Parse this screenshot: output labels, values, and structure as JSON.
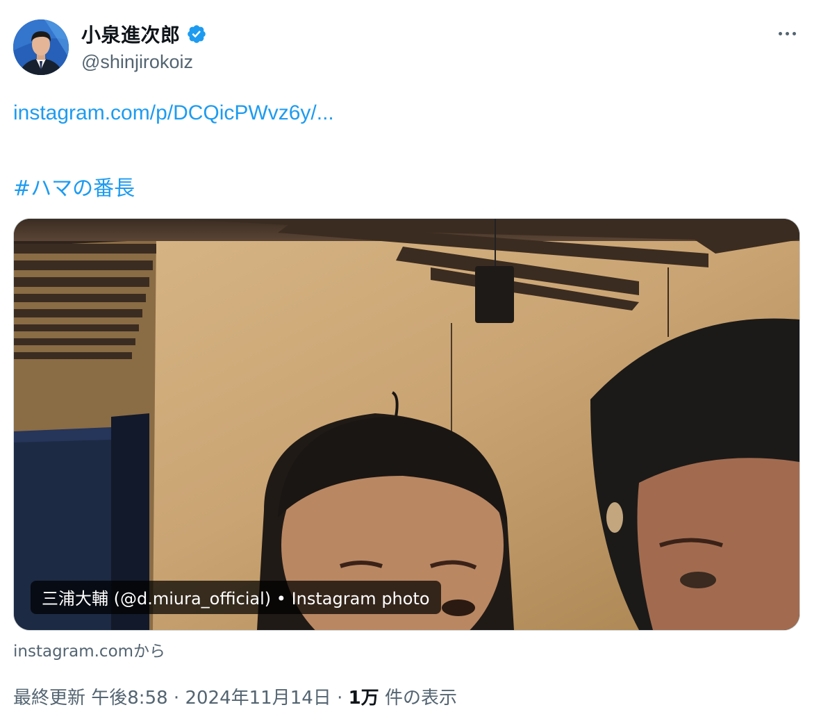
{
  "author": {
    "display_name": "小泉進次郎",
    "handle": "@shinjirokoiz",
    "verified_icon": "verified-badge-icon",
    "avatar_icon": "profile-photo"
  },
  "more_icon": "more-options-icon",
  "tweet": {
    "link_text": "instagram.com/p/DCQicPWvz6y/...",
    "hashtag": "#ハマの番長"
  },
  "card": {
    "caption": "三浦大輔 (@d.miura_official) • Instagram photo",
    "source": "instagram.comから"
  },
  "meta": {
    "time": "最終更新 午後8:58",
    "separator": "·",
    "date": "2024年11月14日",
    "views_count": "1万",
    "views_label": "件の表示"
  },
  "colors": {
    "link": "#1d9bf0",
    "secondary_text": "#536471",
    "verified": "#1d9bf0"
  }
}
